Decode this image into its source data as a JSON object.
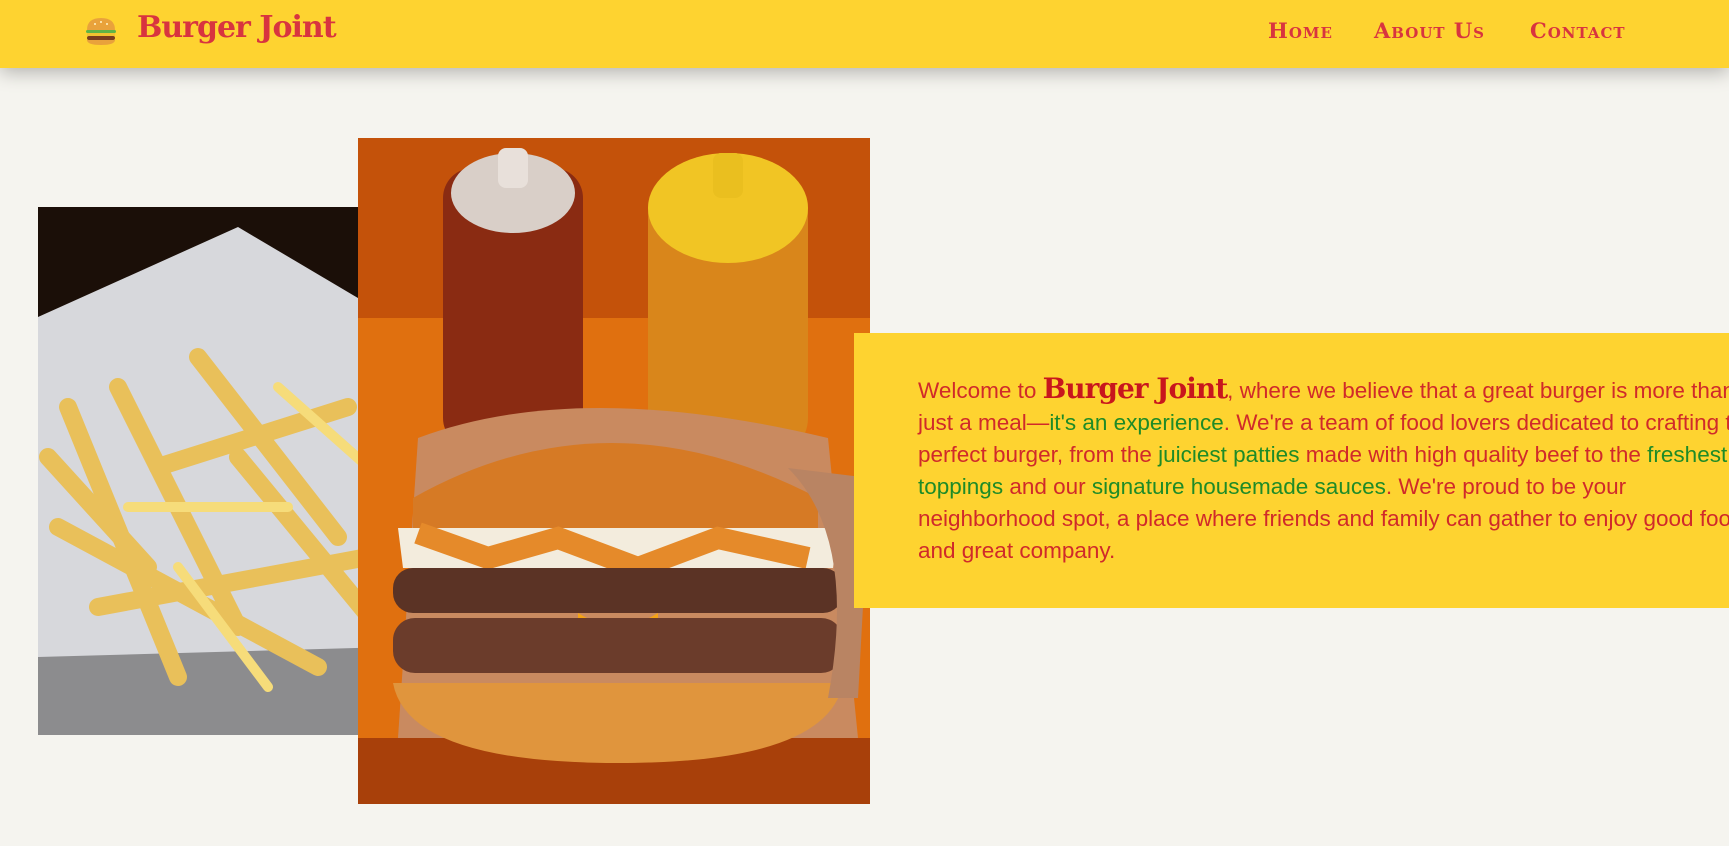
{
  "brand": {
    "name": "Burger Joint",
    "logo_icon": "burger-icon"
  },
  "nav": {
    "links": [
      {
        "label": "Home"
      },
      {
        "label": "About Us"
      },
      {
        "label": "Contact"
      }
    ]
  },
  "images": {
    "fries": {
      "icon": "fries-photo"
    },
    "burger": {
      "icon": "burger-photo"
    }
  },
  "about": {
    "p1": "Welcome to ",
    "brand": "Burger Joint",
    "p2": ", where we believe that a great burger is more than just a meal—",
    "h1": "it's an experience",
    "p3": ". We're a team of food lovers dedicated to crafting the perfect burger, from the ",
    "h2": "juiciest patties",
    "p4": " made with high quality beef to the ",
    "h3": "freshest toppings",
    "p5": " and our ",
    "h4": "signature housemade sauces",
    "p6": ". We're proud to be your neighborhood spot, a place where friends and family can gather to enjoy good food and great company."
  },
  "colors": {
    "header_bg": "#fed330",
    "brand_red": "#d8343f",
    "highlight_green": "#1e8b27",
    "page_bg": "#f5f4ef"
  }
}
